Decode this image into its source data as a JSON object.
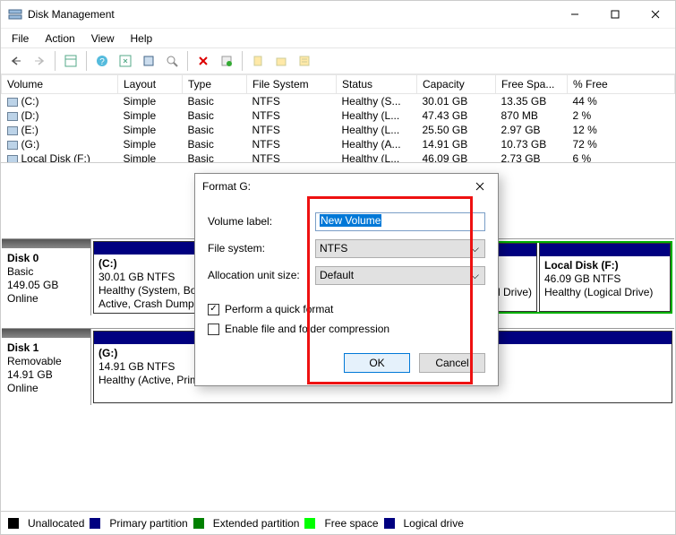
{
  "window": {
    "title": "Disk Management"
  },
  "menu": {
    "file": "File",
    "action": "Action",
    "view": "View",
    "help": "Help"
  },
  "columns": {
    "volume": "Volume",
    "layout": "Layout",
    "type": "Type",
    "fs": "File System",
    "status": "Status",
    "capacity": "Capacity",
    "free": "Free Spa...",
    "pct": "% Free"
  },
  "rows": [
    {
      "vol": "(C:)",
      "layout": "Simple",
      "type": "Basic",
      "fs": "NTFS",
      "status": "Healthy (S...",
      "cap": "30.01 GB",
      "free": "13.35 GB",
      "pct": "44 %"
    },
    {
      "vol": "(D:)",
      "layout": "Simple",
      "type": "Basic",
      "fs": "NTFS",
      "status": "Healthy (L...",
      "cap": "47.43 GB",
      "free": "870 MB",
      "pct": "2 %"
    },
    {
      "vol": "(E:)",
      "layout": "Simple",
      "type": "Basic",
      "fs": "NTFS",
      "status": "Healthy (L...",
      "cap": "25.50 GB",
      "free": "2.97 GB",
      "pct": "12 %"
    },
    {
      "vol": "(G:)",
      "layout": "Simple",
      "type": "Basic",
      "fs": "NTFS",
      "status": "Healthy (A...",
      "cap": "14.91 GB",
      "free": "10.73 GB",
      "pct": "72 %"
    },
    {
      "vol": "Local Disk  (F:)",
      "layout": "Simple",
      "type": "Basic",
      "fs": "NTFS",
      "status": "Healthy (L...",
      "cap": "46.09 GB",
      "free": "2.73 GB",
      "pct": "6 %"
    }
  ],
  "disk0": {
    "name": "Disk 0",
    "type": "Basic",
    "size": "149.05 GB",
    "state": "Online",
    "p1": {
      "title": "(C:)",
      "line2": "30.01 GB NTFS",
      "line3": "Healthy (System, Boot, Page File, Active, Crash Dump, Primary Partition)"
    },
    "pF": {
      "title": "Local Disk   (F:)",
      "line2": "46.09 GB NTFS",
      "line3": "Healthy (Logical Drive)"
    },
    "pHidden": {
      "line3": "l Drive)"
    }
  },
  "disk1": {
    "name": "Disk 1",
    "type": "Removable",
    "size": "14.91 GB",
    "state": "Online",
    "p1": {
      "title": "(G:)",
      "line2": "14.91 GB NTFS",
      "line3": "Healthy (Active, Primary Partition)"
    }
  },
  "legend": {
    "unalloc": "Unallocated",
    "primary": "Primary partition",
    "extended": "Extended partition",
    "free": "Free space",
    "logical": "Logical drive"
  },
  "dialog": {
    "title": "Format G:",
    "labels": {
      "vol": "Volume label:",
      "fs": "File system:",
      "aus": "Allocation unit size:"
    },
    "values": {
      "vol": "New Volume",
      "fs": "NTFS",
      "aus": "Default"
    },
    "chk1": "Perform a quick format",
    "chk2": "Enable file and folder compression",
    "ok": "OK",
    "cancel": "Cancel",
    "quickFormatChecked": true,
    "compressionChecked": false
  },
  "colors": {
    "navy": "#000080",
    "green": "#00a000",
    "lime": "#00ff00",
    "black": "#000000",
    "highlightRed": "#e11"
  }
}
